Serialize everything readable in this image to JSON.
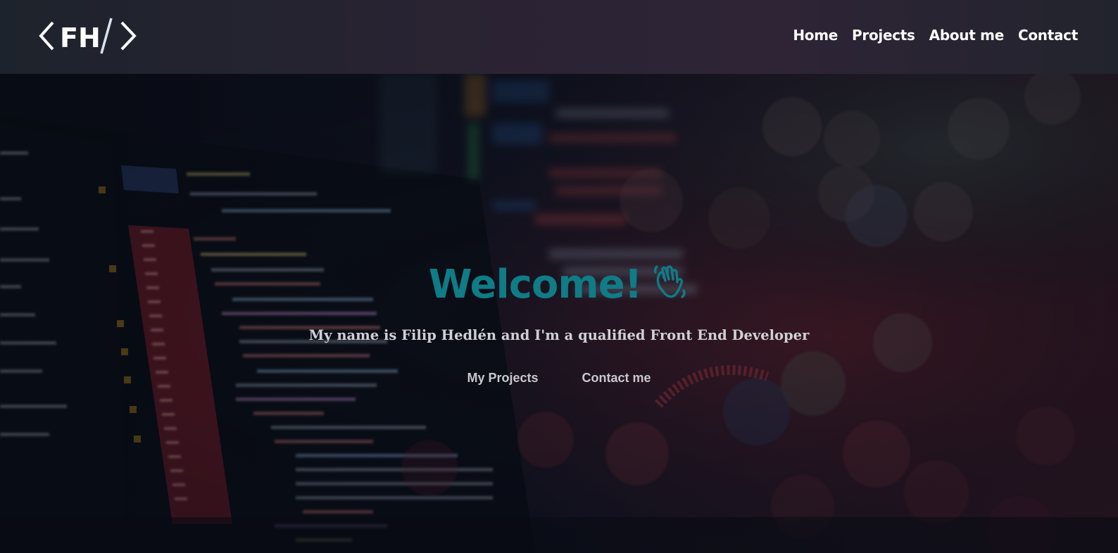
{
  "header": {
    "logo_text": "FH",
    "nav": [
      {
        "label": "Home"
      },
      {
        "label": "Projects"
      },
      {
        "label": "About me"
      },
      {
        "label": "Contact"
      }
    ]
  },
  "hero": {
    "title": "Welcome!",
    "title_icon": "waving-hand-icon",
    "subtitle": "My name is Filip Hedlén and I'm a qualified Front End Developer",
    "buttons": [
      {
        "label": "My Projects"
      },
      {
        "label": "Contact me"
      }
    ]
  },
  "colors": {
    "accent": "#0f7c86",
    "header_bg": "#2b2333",
    "text_light": "#ffffff"
  }
}
